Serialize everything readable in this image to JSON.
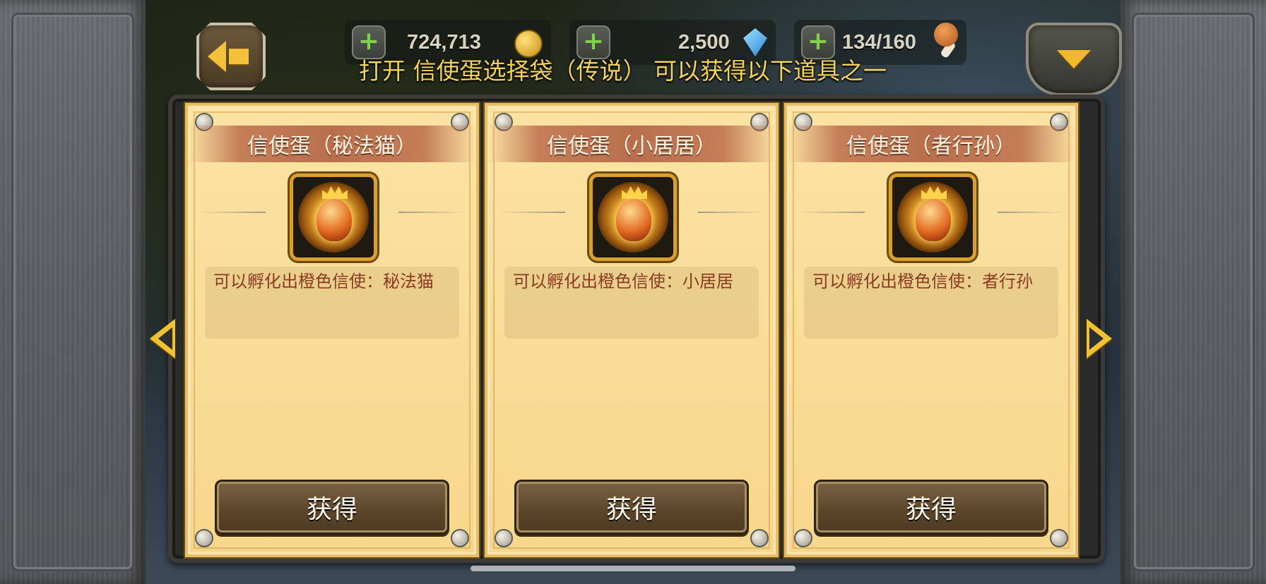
{
  "topbar": {
    "gold": "724,713",
    "gems": "2,500",
    "stamina": "134/160",
    "headline": "打开  信使蛋选择袋（传说）  可以获得以下道具之一"
  },
  "cards": [
    {
      "title": "信使蛋（秘法猫）",
      "desc": "可以孵化出橙色信使：秘法猫",
      "button": "获得",
      "icon": "egg-icon"
    },
    {
      "title": "信使蛋（小居居）",
      "desc": "可以孵化出橙色信使：小居居",
      "button": "获得",
      "icon": "egg-icon"
    },
    {
      "title": "信使蛋（者行孙）",
      "desc": "可以孵化出橙色信使：者行孙",
      "button": "获得",
      "icon": "egg-icon"
    }
  ],
  "colors": {
    "accent_gold": "#f5d35a",
    "card_bg": "#f7d78b",
    "button_brown": "#5b4529",
    "desc_text": "#8a3b22"
  }
}
